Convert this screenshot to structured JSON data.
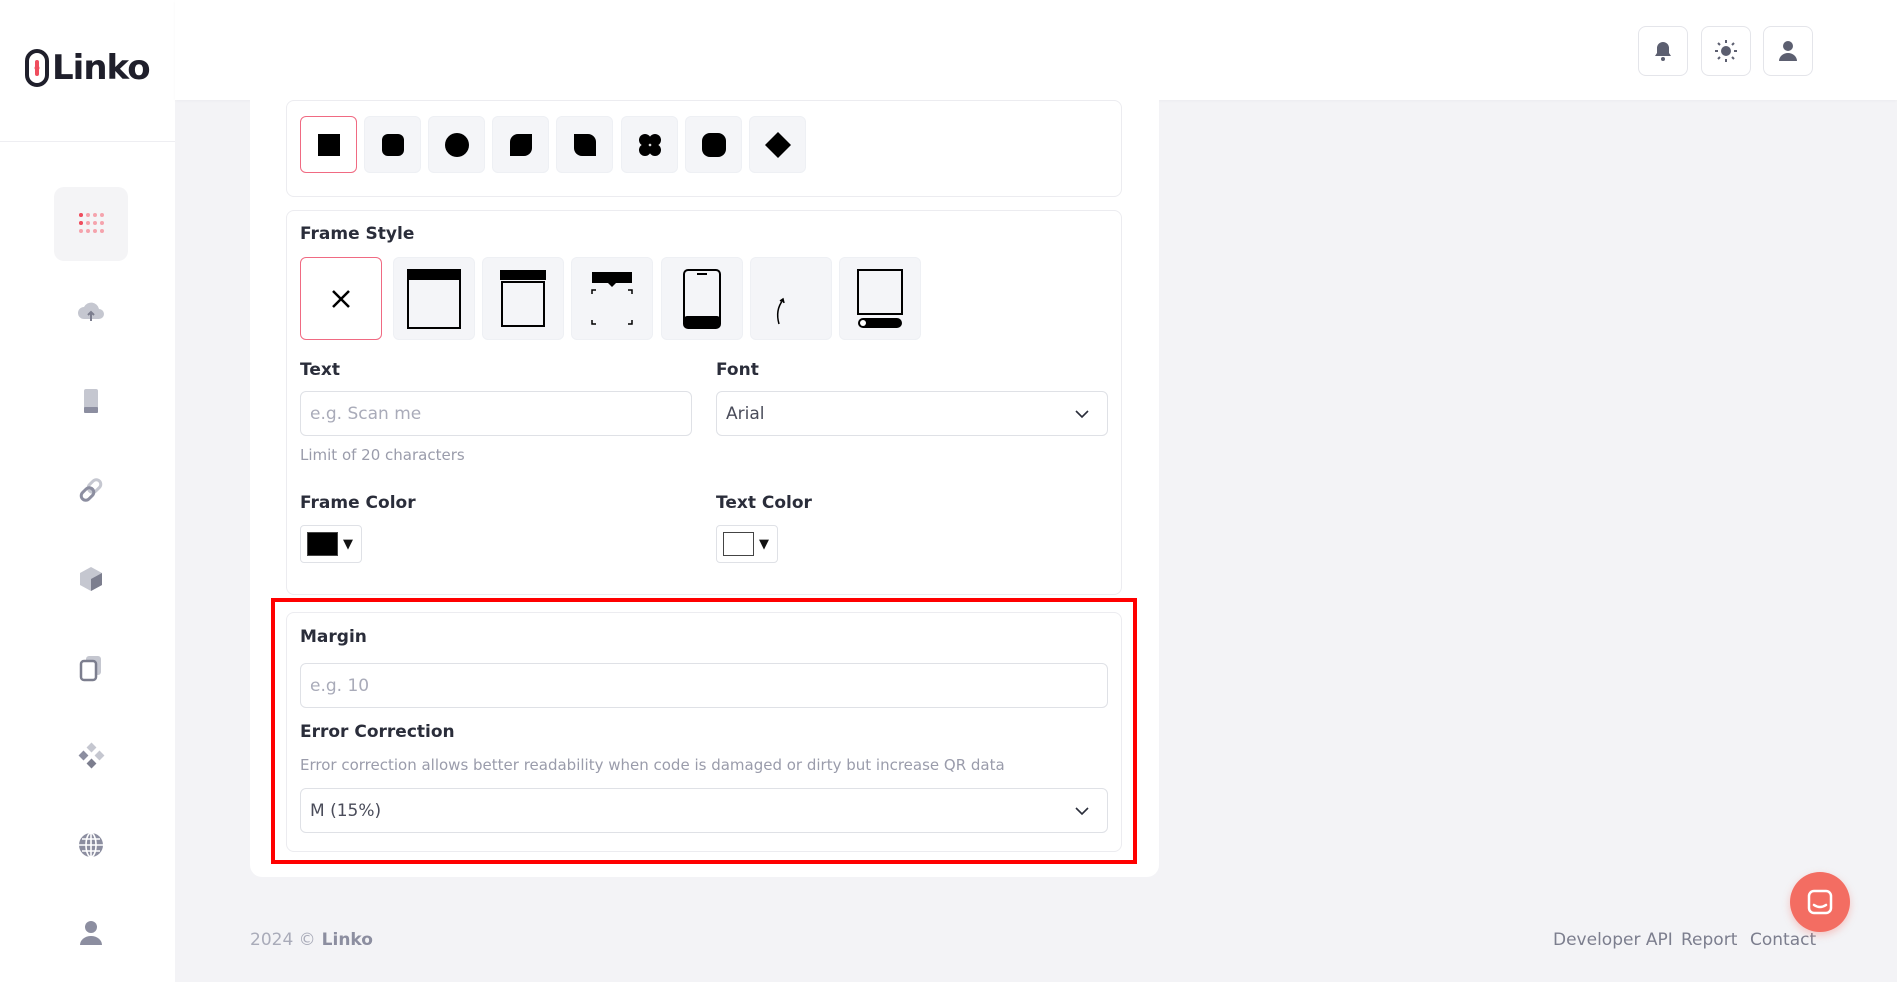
{
  "brand": {
    "name": "Linko",
    "accent": "#f06a82"
  },
  "sidebar": {
    "items": [
      {
        "icon": "dashboard-grid-icon",
        "active": true
      },
      {
        "icon": "cloud-upload-icon"
      },
      {
        "icon": "phone-icon"
      },
      {
        "icon": "link-icon"
      },
      {
        "icon": "box-icon"
      },
      {
        "icon": "copy-icon"
      },
      {
        "icon": "nodes-icon"
      },
      {
        "icon": "globe-icon"
      },
      {
        "icon": "user-icon"
      }
    ]
  },
  "header": {
    "buttons": [
      {
        "icon": "bell-icon"
      },
      {
        "icon": "sun-icon"
      },
      {
        "icon": "user-icon"
      }
    ]
  },
  "eye_style": {
    "options": [
      "square",
      "rounded",
      "circle",
      "leaf",
      "leaf-reverse",
      "flower",
      "rounded-square",
      "diamond"
    ],
    "selected": "square"
  },
  "frame_style": {
    "label": "Frame Style",
    "options": [
      "none",
      "top-bar",
      "banner-top",
      "speech-corners",
      "phone",
      "arrow",
      "bottom-bar"
    ],
    "selected": "none"
  },
  "text_field": {
    "label": "Text",
    "placeholder": "e.g. Scan me",
    "hint": "Limit of 20 characters",
    "value": ""
  },
  "font_field": {
    "label": "Font",
    "value": "Arial"
  },
  "frame_color": {
    "label": "Frame Color",
    "value": "#000000"
  },
  "text_color": {
    "label": "Text Color",
    "value": "#ffffff"
  },
  "margin_field": {
    "label": "Margin",
    "placeholder": "e.g. 10",
    "value": ""
  },
  "error_correction": {
    "label": "Error Correction",
    "hint": "Error correction allows better readability when code is damaged or dirty but increase QR data",
    "value": "M (15%)"
  },
  "footer": {
    "year": "2024 ©",
    "brand": "Linko",
    "links": [
      "Developer API",
      "Report",
      "Contact"
    ]
  },
  "chat": {
    "icon": "chat-icon"
  }
}
